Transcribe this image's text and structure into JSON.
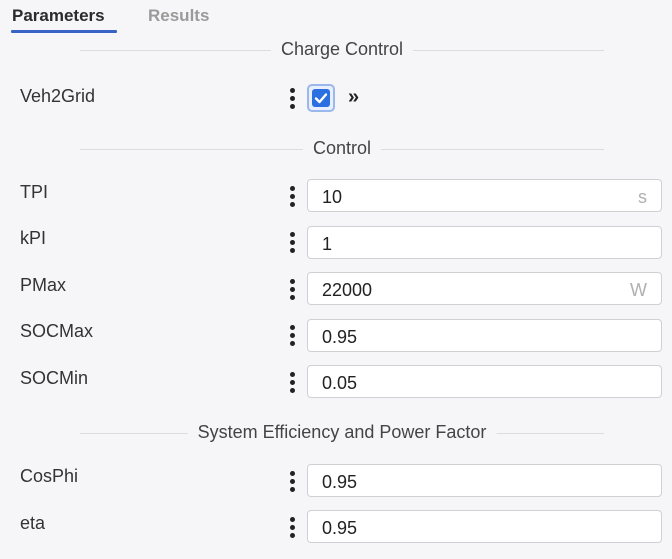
{
  "tabs": [
    {
      "label": "Parameters",
      "active": true
    },
    {
      "label": "Results",
      "active": false
    }
  ],
  "sections": {
    "charge_control": "Charge Control",
    "control": "Control",
    "efficiency": "System Efficiency and Power Factor"
  },
  "params": {
    "veh2grid": {
      "label": "Veh2Grid",
      "checked": true,
      "expand_icon": "»"
    },
    "tpi": {
      "label": "TPI",
      "value": "10",
      "unit": "s"
    },
    "kpi": {
      "label": "kPI",
      "value": "1",
      "unit": ""
    },
    "pmax": {
      "label": "PMax",
      "value": "22000",
      "unit": "W"
    },
    "socmax": {
      "label": "SOCMax",
      "value": "0.95",
      "unit": ""
    },
    "socmin": {
      "label": "SOCMin",
      "value": "0.05",
      "unit": ""
    },
    "cosphi": {
      "label": "CosPhi",
      "value": "0.95",
      "unit": ""
    },
    "eta": {
      "label": "eta",
      "value": "0.95",
      "unit": ""
    }
  },
  "colors": {
    "accent": "#3a63c8",
    "checkbox": "#2b6fe0",
    "background": "#f6f6f8"
  }
}
